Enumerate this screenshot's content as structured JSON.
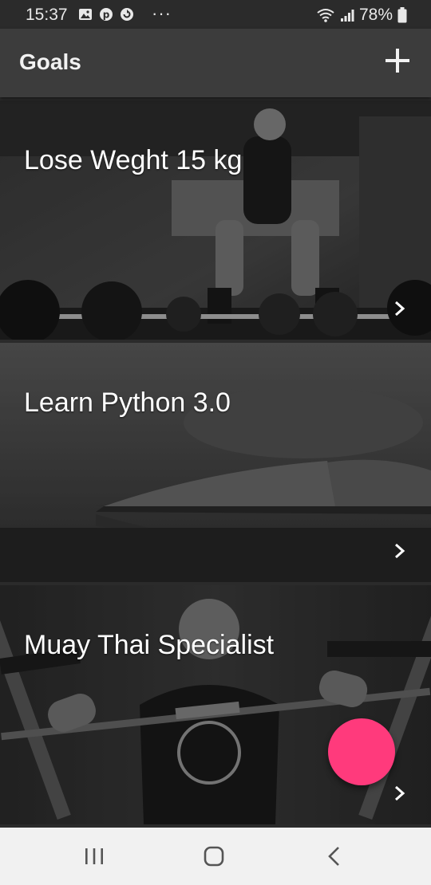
{
  "status_bar": {
    "time": "15:37",
    "notification_icons": [
      "gallery-icon",
      "pinterest-icon",
      "sync-icon"
    ],
    "more": "···",
    "battery": "78%"
  },
  "app_bar": {
    "title": "Goals",
    "add_icon": "plus-icon"
  },
  "goals": [
    {
      "title": "Lose Weght 15 kg",
      "image": "weightlifting-photo"
    },
    {
      "title": "Learn Python 3.0",
      "image": "open-book-photo"
    },
    {
      "title": "Muay Thai Specialist",
      "image": "bench-press-photo"
    }
  ],
  "fab": {
    "color": "#ff3a7c"
  },
  "nav_bar": {
    "buttons": [
      "recent-apps-icon",
      "home-icon",
      "back-icon"
    ]
  }
}
